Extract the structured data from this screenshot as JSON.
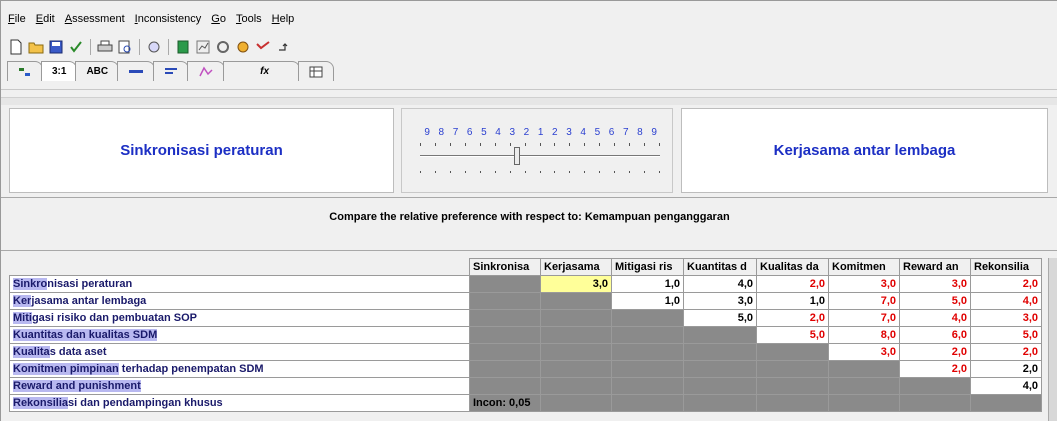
{
  "menu": [
    "File",
    "Edit",
    "Assessment",
    "Inconsistency",
    "Go",
    "Tools",
    "Help"
  ],
  "toolbar_icons": [
    "new-icon",
    "open-icon",
    "save-icon",
    "checkmark-icon",
    "print-icon",
    "print-preview-icon",
    "wizard-icon",
    "calculator-icon",
    "chart-icon",
    "network-icon",
    "refresh-icon",
    "arrow-sign-icon"
  ],
  "tabs": [
    "3:1",
    "ABC",
    "",
    "",
    "",
    "fx",
    ""
  ],
  "comparison": {
    "left_label": "Sinkronisasi peraturan",
    "right_label": "Kerjasama antar lembaga",
    "scale_numbers": [
      "9",
      "8",
      "7",
      "6",
      "5",
      "4",
      "3",
      "2",
      "1",
      "2",
      "3",
      "4",
      "5",
      "6",
      "7",
      "8",
      "9"
    ],
    "slider_value": 3,
    "prompt": "Compare the relative preference with respect to: Kemampuan penganggaran"
  },
  "matrix": {
    "columns": [
      "Sinkronisa",
      "Kerjasama",
      "Mitigasi ris",
      "Kuantitas d",
      "Kualitas da",
      "Komitmen",
      "Reward an",
      "Rekonsilia"
    ],
    "rows": [
      {
        "full": "Sinkronisasi peraturan",
        "hl": "Sinkro",
        "rest": "nisasi peraturan",
        "cells": [
          "g",
          "3,0",
          "1,0",
          "4,0",
          "2,0",
          "3,0",
          "3,0",
          "2,0"
        ],
        "red": [
          4,
          5,
          6,
          7
        ],
        "sel": 1
      },
      {
        "full": "Kerjasama antar lembaga",
        "hl": "Ker",
        "rest": "jasama antar lembaga",
        "cells": [
          "g",
          "g",
          "1,0",
          "3,0",
          "1,0",
          "7,0",
          "5,0",
          "4,0"
        ],
        "red": [
          5,
          6,
          7
        ]
      },
      {
        "full": "Mitigasi risiko dan pembuatan SOP",
        "hl": "Miti",
        "rest": "gasi risiko dan pembuatan SOP",
        "cells": [
          "g",
          "g",
          "g",
          "5,0",
          "2,0",
          "7,0",
          "4,0",
          "3,0"
        ],
        "red": [
          4,
          5,
          6,
          7
        ]
      },
      {
        "full": "Kuantitas dan kualitas SDM",
        "hl": "Kuantitas dan kualitas SDM",
        "rest": "",
        "cells": [
          "g",
          "g",
          "g",
          "g",
          "5,0",
          "8,0",
          "6,0",
          "5,0"
        ],
        "red": [
          4,
          5,
          6,
          7
        ]
      },
      {
        "full": "Kualitas data aset",
        "hl": "Kualita",
        "rest": "s data aset",
        "cells": [
          "g",
          "g",
          "g",
          "g",
          "g",
          "3,0",
          "2,0",
          "2,0"
        ],
        "red": [
          5,
          6,
          7
        ]
      },
      {
        "full": "Komitmen pimpinan terhadap penempatan SDM",
        "hl": "Komitmen pimpinan",
        "rest": " terhadap penempatan SDM",
        "cells": [
          "g",
          "g",
          "g",
          "g",
          "g",
          "g",
          "2,0",
          "2,0"
        ],
        "red": [
          6
        ]
      },
      {
        "full": "Reward and punishment",
        "hl": "Reward and punishment",
        "rest": "",
        "cells": [
          "g",
          "g",
          "g",
          "g",
          "g",
          "g",
          "g",
          "4,0"
        ],
        "red": []
      },
      {
        "full": "Rekonsiliasi dan pendampingan khusus",
        "hl": "Rekonsilia",
        "rest": "si dan pendampingan khusus",
        "cells": [
          "incon",
          "g",
          "g",
          "g",
          "g",
          "g",
          "g",
          "g"
        ],
        "red": []
      }
    ],
    "incon_label": "Incon: 0,05"
  }
}
